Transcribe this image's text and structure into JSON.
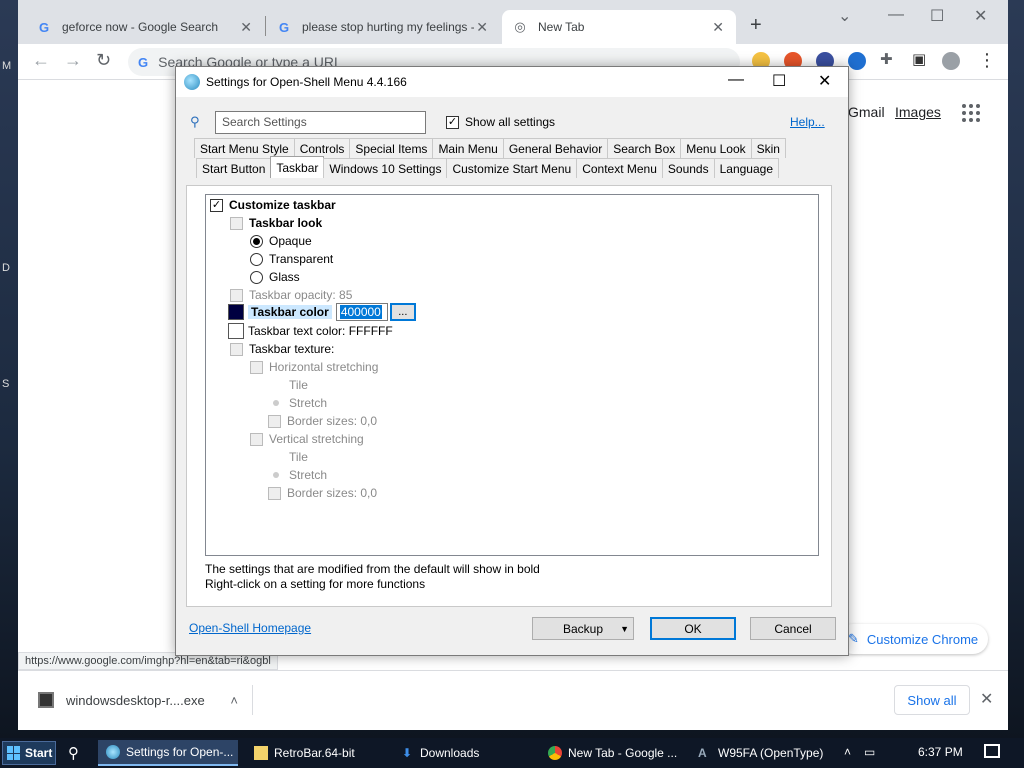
{
  "chrome": {
    "tabs": [
      {
        "label": "geforce now - Google Search",
        "favicon": "G"
      },
      {
        "label": "please stop hurting my feelings -",
        "favicon": "G"
      },
      {
        "label": "New Tab",
        "favicon": "chrome"
      }
    ],
    "omnibox_placeholder": "Search Google or type a URL",
    "page": {
      "gmail": "Gmail",
      "images": "Images",
      "customize": "Customize Chrome"
    },
    "status_url": "https://www.google.com/imghp?hl=en&tab=ri&ogbl",
    "download": {
      "filename": "windowsdesktop-r....exe",
      "show_all": "Show all"
    }
  },
  "dialog": {
    "title": "Settings for Open-Shell Menu 4.4.166",
    "search_placeholder": "Search Settings",
    "show_all_settings": "Show all settings",
    "help": "Help...",
    "tabs_row1": [
      "Start Menu Style",
      "Controls",
      "Special Items",
      "Main Menu",
      "General Behavior",
      "Search Box",
      "Menu Look",
      "Skin"
    ],
    "tabs_row2": [
      "Start Button",
      "Taskbar",
      "Windows 10 Settings",
      "Customize Start Menu",
      "Context Menu",
      "Sounds",
      "Language"
    ],
    "active_tab": "Taskbar",
    "tree": {
      "customize_taskbar": "Customize taskbar",
      "taskbar_look": "Taskbar look",
      "opaque": "Opaque",
      "transparent": "Transparent",
      "glass": "Glass",
      "opacity": "Taskbar opacity: 85",
      "color_label": "Taskbar color",
      "color_value": "400000",
      "color_btn": "...",
      "text_color": "Taskbar text color: FFFFFF",
      "texture": "Taskbar texture:",
      "horizontal": "Horizontal stretching",
      "h_tile": "Tile",
      "h_stretch": "Stretch",
      "h_border": "Border sizes: 0,0",
      "vertical": "Vertical stretching",
      "v_tile": "Tile",
      "v_stretch": "Stretch",
      "v_border": "Border sizes: 0,0"
    },
    "note1": "The settings that are modified from the default will show in bold",
    "note2": "Right-click on a setting for more functions",
    "homepage": "Open-Shell Homepage",
    "backup": "Backup",
    "ok": "OK",
    "cancel": "Cancel",
    "colors": {
      "taskbar_color_swatch": "#000040",
      "text_color_swatch": "#FFFFFF"
    }
  },
  "taskbar": {
    "start": "Start",
    "items": [
      "Settings for Open-...",
      "RetroBar.64-bit",
      "Downloads",
      "New Tab - Google ...",
      "W95FA (OpenType)"
    ],
    "clock": "6:37 PM"
  }
}
